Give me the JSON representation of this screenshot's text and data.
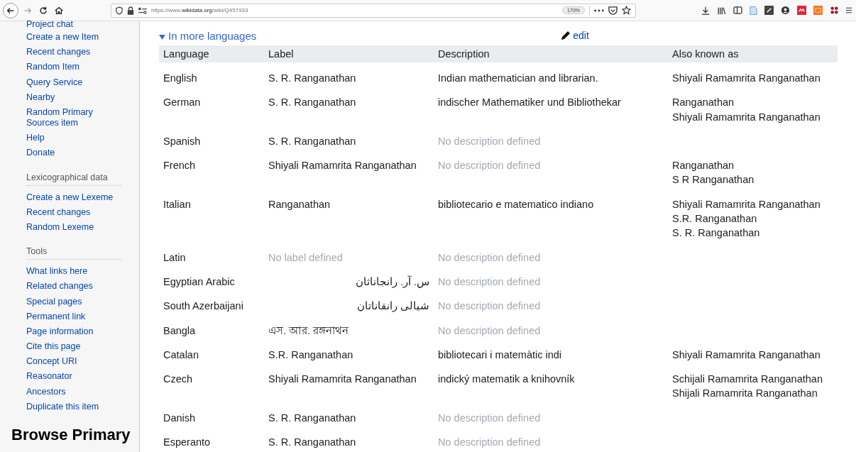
{
  "browser": {
    "url_host": "https://www.",
    "url_domain": "wikidata.org",
    "url_path": "/wiki/Q457933",
    "zoom": "170%",
    "forward_disabled": true
  },
  "sidebar": {
    "navigation": [
      "Project chat",
      "Create a new Item",
      "Recent changes",
      "Random Item",
      "Query Service",
      "Nearby",
      "Random Primary Sources item",
      "Help",
      "Donate"
    ],
    "sections": [
      {
        "heading": "Lexicographical data",
        "items": [
          "Create a new Lexeme",
          "Recent changes",
          "Random Lexeme"
        ]
      },
      {
        "heading": "Tools",
        "items": [
          "What links here",
          "Related changes",
          "Special pages",
          "Permanent link",
          "Page information",
          "Cite this page",
          "Concept URI",
          "Reasonator",
          "Ancestors",
          "Duplicate this item"
        ]
      }
    ],
    "footer_heading": "Browse Primary"
  },
  "section": {
    "title": "In more languages",
    "expanded": true,
    "edit": "edit"
  },
  "table": {
    "columns": [
      "Language",
      "Label",
      "Description",
      "Also known as"
    ],
    "rows": [
      {
        "language": "English",
        "label": "S. R. Ranganathan",
        "label_defined": true,
        "description": "Indian mathematician and librarian.",
        "description_defined": true,
        "aliases": [
          "Shiyali Ramamrita Ranganathan"
        ]
      },
      {
        "language": "German",
        "label": "S. R. Ranganathan",
        "label_defined": true,
        "description": "indischer Mathematiker und Bibliothekar",
        "description_defined": true,
        "aliases": [
          "Ranganathan",
          "Shiyali Ramamrita Ranganathan"
        ]
      },
      {
        "language": "Spanish",
        "label": "S. R. Ranganathan",
        "label_defined": true,
        "description": "No description defined",
        "description_defined": false,
        "aliases": []
      },
      {
        "language": "French",
        "label": "Shiyali Ramamrita Ranganathan",
        "label_defined": true,
        "description": "No description defined",
        "description_defined": false,
        "aliases": [
          "Ranganathan",
          "S R Ranganathan"
        ]
      },
      {
        "language": "Italian",
        "label": "Ranganathan",
        "label_defined": true,
        "description": "bibliotecario e matematico indiano",
        "description_defined": true,
        "aliases": [
          "Shiyali Ramamrita Ranganathan",
          "S.R. Ranganathan",
          "S. R. Ranganathan"
        ]
      },
      {
        "language": "Latin",
        "label": "No label defined",
        "label_defined": false,
        "description": "No description defined",
        "description_defined": false,
        "aliases": []
      },
      {
        "language": "Egyptian Arabic",
        "label": "س. آر. رانجاناثان",
        "label_defined": true,
        "description": "No description defined",
        "description_defined": false,
        "aliases": []
      },
      {
        "language": "South Azerbaijani",
        "label": "شیالی رانقاناتان",
        "label_defined": true,
        "description": "No description defined",
        "description_defined": false,
        "aliases": []
      },
      {
        "language": "Bangla",
        "label": "এস. আর. রঙ্গনাথন",
        "label_defined": true,
        "description": "No description defined",
        "description_defined": false,
        "aliases": []
      },
      {
        "language": "Catalan",
        "label": "S.R. Ranganathan",
        "label_defined": true,
        "description": "bibliotecari i matemàtic indi",
        "description_defined": true,
        "aliases": [
          "Shiyali Ramamrita Ranganathan"
        ]
      },
      {
        "language": "Czech",
        "label": "Shiyali Ramamrita Ranganathan",
        "label_defined": true,
        "description": "indický matematik a knihovník",
        "description_defined": true,
        "aliases": [
          "Schijali Ramamrita Ranganathan",
          "Shijali Ramamrita Ranganathan"
        ]
      },
      {
        "language": "Danish",
        "label": "S. R. Ranganathan",
        "label_defined": true,
        "description": "No description defined",
        "description_defined": false,
        "aliases": []
      },
      {
        "language": "Esperanto",
        "label": "S. R. Ranganathan",
        "label_defined": true,
        "description": "No description defined",
        "description_defined": false,
        "aliases": []
      }
    ]
  }
}
